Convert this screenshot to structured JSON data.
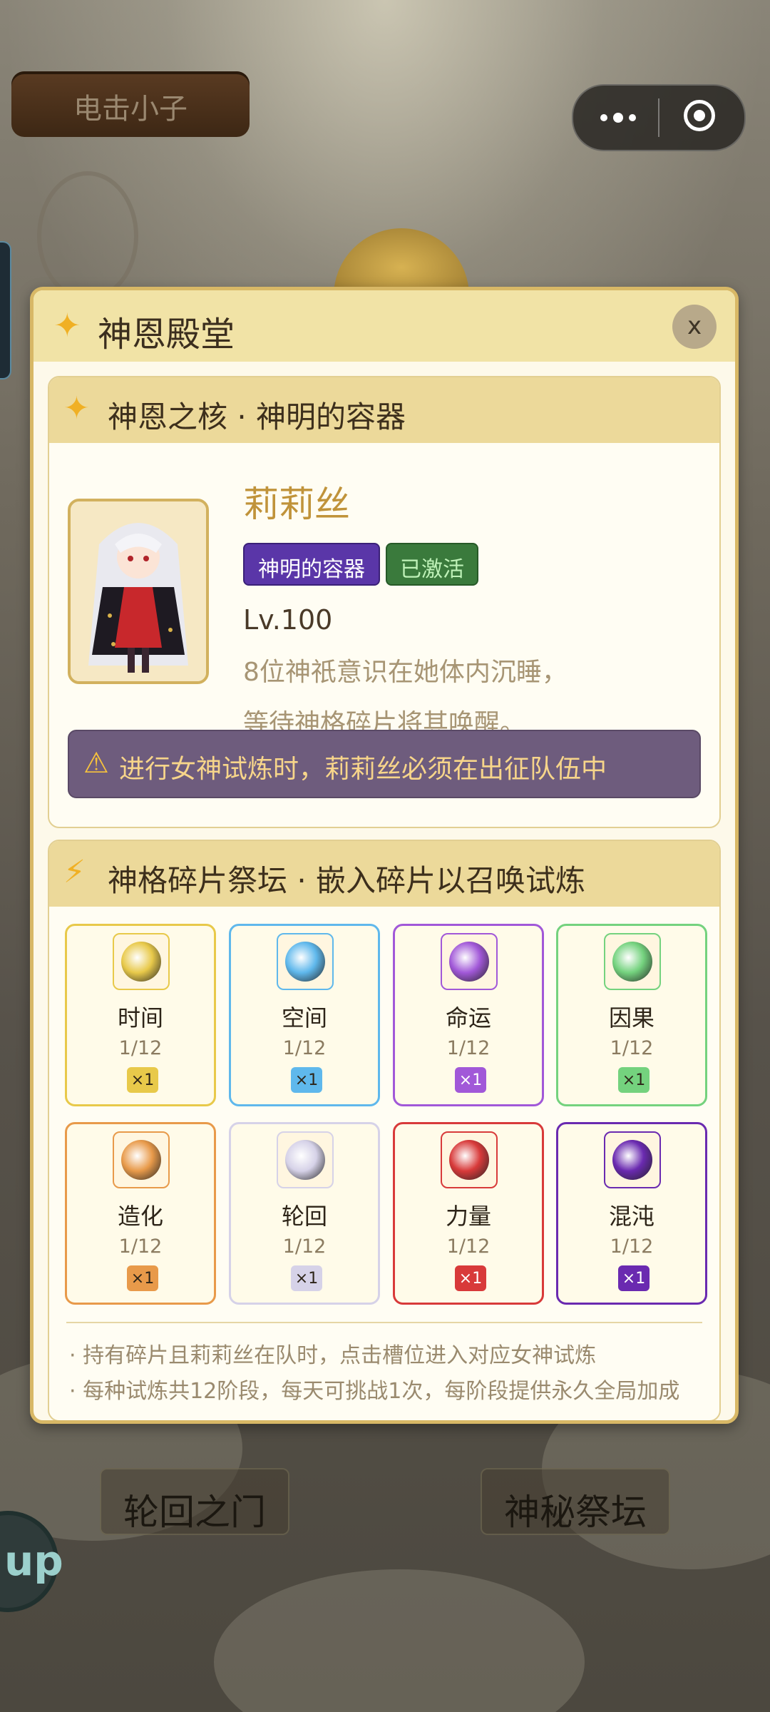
{
  "app": {
    "title": "电击小子",
    "menu_icon": "more-dots-icon",
    "record_icon": "target-icon"
  },
  "background": {
    "left_button": "轮回之门",
    "right_button": "神秘祭坛",
    "badge_text": "up"
  },
  "modal": {
    "title": "神恩殿堂",
    "close_label": "x",
    "core_section": {
      "title": "神恩之核 · 神明的容器",
      "character_name": "莉莉丝",
      "tags": [
        {
          "label": "神明的容器",
          "color": "#5a36a8"
        },
        {
          "label": "已激活",
          "color": "#3a7a3c"
        }
      ],
      "level": "Lv.100",
      "description_lines": [
        "8位神祇意识在她体内沉睡，",
        "等待神格碎片将其唤醒。"
      ],
      "warning_icon": "warning-icon",
      "warning": "进行女神试炼时，莉莉丝必须在出征队伍中"
    },
    "altar_section": {
      "title": "神格碎片祭坛 · 嵌入碎片以召唤试炼",
      "slots": [
        {
          "name": "时间",
          "progress": "1/12",
          "qty": "×1",
          "color": "#e8c94a",
          "icon": "hourglass-shard-icon"
        },
        {
          "name": "空间",
          "progress": "1/12",
          "qty": "×1",
          "color": "#5fb8ec",
          "icon": "vortex-shard-icon"
        },
        {
          "name": "命运",
          "progress": "1/12",
          "qty": "×1",
          "color": "#a158d8",
          "icon": "fate-orb-icon"
        },
        {
          "name": "因果",
          "progress": "1/12",
          "qty": "×1",
          "color": "#74d27e",
          "icon": "karma-orb-icon"
        },
        {
          "name": "造化",
          "progress": "1/12",
          "qty": "×1",
          "color": "#e89a4a",
          "icon": "flame-orb-icon"
        },
        {
          "name": "轮回",
          "progress": "1/12",
          "qty": "×1",
          "color": "#d6d2e8",
          "icon": "cycle-orb-icon"
        },
        {
          "name": "力量",
          "progress": "1/12",
          "qty": "×1",
          "color": "#d83a3a",
          "icon": "power-orb-icon"
        },
        {
          "name": "混沌",
          "progress": "1/12",
          "qty": "×1",
          "color": "#6a2ab0",
          "icon": "chaos-orb-icon"
        }
      ],
      "notes": [
        "· 持有碎片且莉莉丝在队时，点击槽位进入对应女神试炼",
        "· 每种试炼共12阶段，每天可挑战1次，每阶段提供永久全局加成"
      ]
    }
  }
}
